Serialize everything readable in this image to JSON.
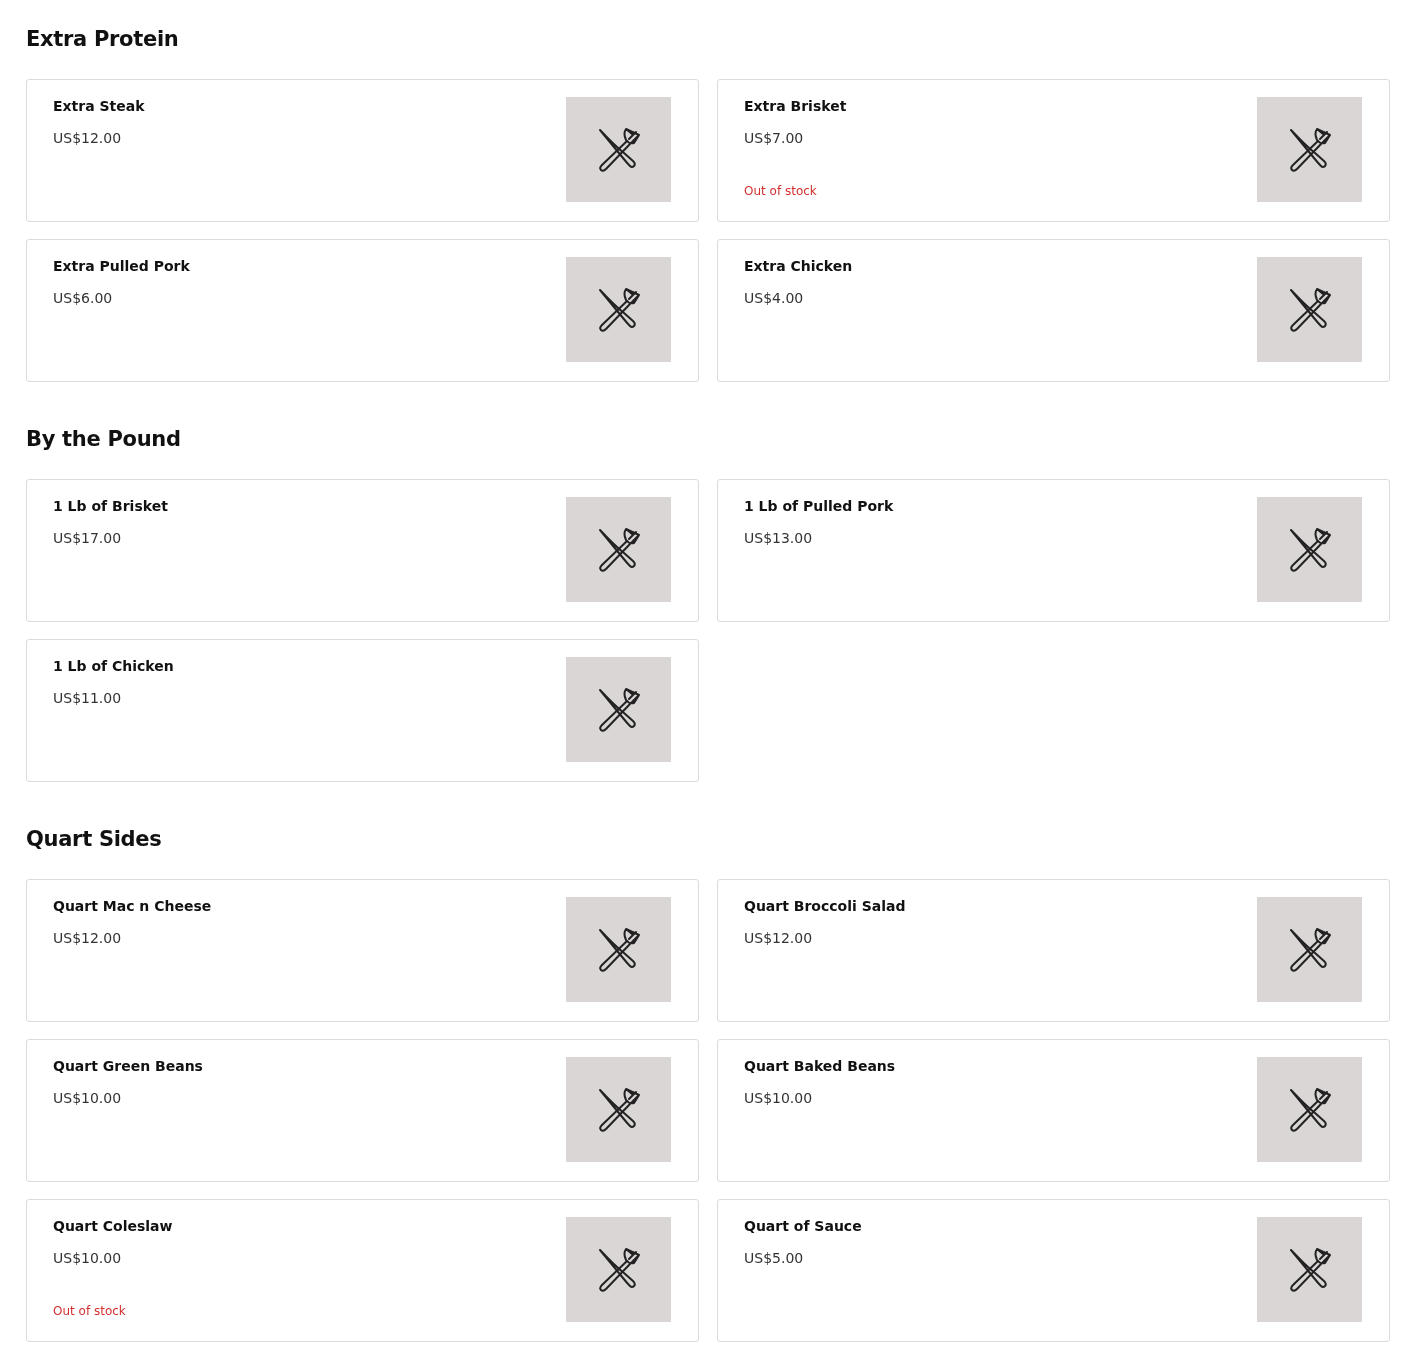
{
  "sections": [
    {
      "title": "Extra Protein",
      "items": [
        {
          "name": "Extra Steak",
          "price": "US$12.00"
        },
        {
          "name": "Extra Brisket",
          "price": "US$7.00",
          "stock_note": "Out of stock"
        },
        {
          "name": "Extra Pulled Pork",
          "price": "US$6.00"
        },
        {
          "name": "Extra Chicken",
          "price": "US$4.00"
        }
      ]
    },
    {
      "title": "By the Pound",
      "items": [
        {
          "name": "1 Lb of Brisket",
          "price": "US$17.00"
        },
        {
          "name": "1 Lb of Pulled Pork",
          "price": "US$13.00"
        },
        {
          "name": "1 Lb of Chicken",
          "price": "US$11.00"
        }
      ]
    },
    {
      "title": "Quart Sides",
      "items": [
        {
          "name": "Quart Mac n Cheese",
          "price": "US$12.00"
        },
        {
          "name": "Quart Broccoli Salad",
          "price": "US$12.00"
        },
        {
          "name": "Quart Green Beans",
          "price": "US$10.00"
        },
        {
          "name": "Quart Baked Beans",
          "price": "US$10.00"
        },
        {
          "name": "Quart Coleslaw",
          "price": "US$10.00",
          "stock_note": "Out of stock"
        },
        {
          "name": "Quart of Sauce",
          "price": "US$5.00"
        }
      ]
    }
  ]
}
